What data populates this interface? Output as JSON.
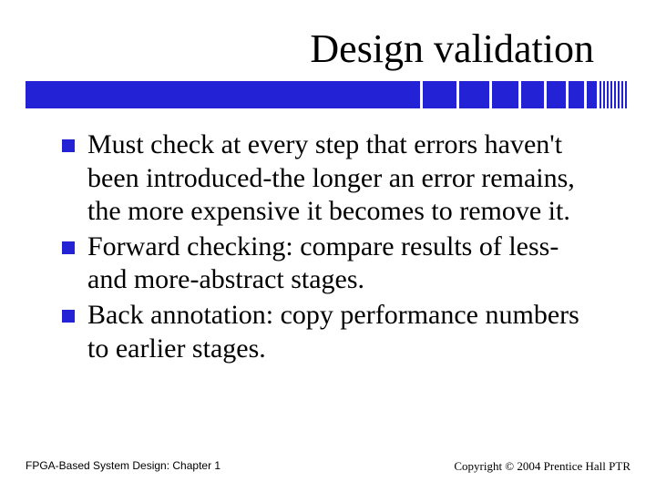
{
  "title": "Design validation",
  "bullets": [
    "Must check at every step that errors haven't been introduced-the longer an error remains, the more expensive it becomes to remove it.",
    "Forward checking: compare results of less- and more-abstract stages.",
    "Back annotation: copy performance numbers to earlier stages."
  ],
  "footer": {
    "left": "FPGA-Based System Design: Chapter 1",
    "right": "Copyright © 2004 Prentice Hall PTR"
  },
  "colors": {
    "accent": "#2323d5"
  }
}
